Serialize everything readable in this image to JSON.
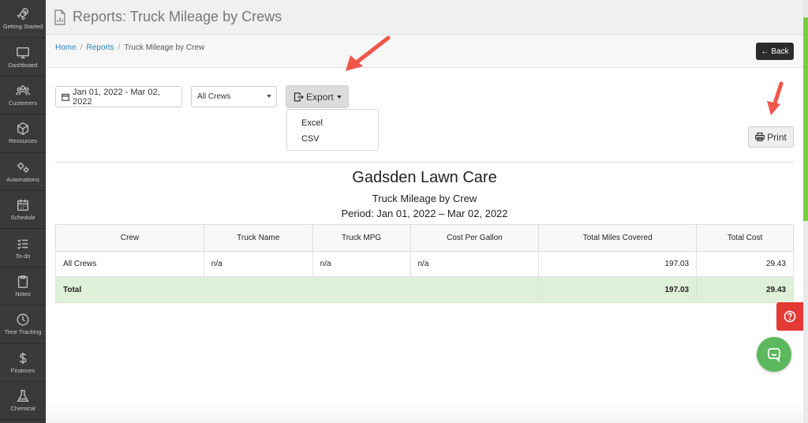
{
  "sidebar": {
    "items": [
      {
        "label": "Getting Started",
        "icon": "rocket-icon"
      },
      {
        "label": "Dashboard",
        "icon": "monitor-icon"
      },
      {
        "label": "Customers",
        "icon": "users-icon"
      },
      {
        "label": "Resources",
        "icon": "cube-icon"
      },
      {
        "label": "Automations",
        "icon": "gears-icon"
      },
      {
        "label": "Schedule",
        "icon": "calendar-icon"
      },
      {
        "label": "To-do",
        "icon": "checklist-icon"
      },
      {
        "label": "Notes",
        "icon": "clipboard-icon"
      },
      {
        "label": "Time Tracking",
        "icon": "clock-icon"
      },
      {
        "label": "Finances",
        "icon": "dollar-icon"
      },
      {
        "label": "Chemical",
        "icon": "flask-icon"
      }
    ]
  },
  "header": {
    "title": "Reports: Truck Mileage by Crews"
  },
  "breadcrumb": {
    "home": "Home",
    "reports": "Reports",
    "current": "Truck Mileage by Crew",
    "separator": "/"
  },
  "back_button": {
    "label": "Back"
  },
  "controls": {
    "date_range": "Jan 01, 2022 - Mar 02, 2022",
    "crew_select": "All Crews",
    "export_label": "Export",
    "export_options": [
      "Excel",
      "CSV"
    ],
    "print_label": "Print"
  },
  "report": {
    "company": "Gadsden Lawn Care",
    "subtitle": "Truck Mileage by Crew",
    "period": "Period: Jan 01, 2022 – Mar 02, 2022",
    "columns": [
      "Crew",
      "Truck Name",
      "Truck MPG",
      "Cost Per Gallon",
      "Total Miles Covered",
      "Total Cost"
    ],
    "rows": [
      [
        "All Crews",
        "n/a",
        "n/a",
        "n/a",
        "197.03",
        "29.43"
      ]
    ],
    "total": {
      "label": "Total",
      "miles": "197.03",
      "cost": "29.43"
    }
  },
  "colors": {
    "sidebar_bg": "#3a3a3a",
    "link": "#2a7fc1",
    "total_row": "#dff0d8",
    "help_button": "#e53935",
    "chat_button": "#5cb85c",
    "annotation_arrow": "#f0564a"
  }
}
